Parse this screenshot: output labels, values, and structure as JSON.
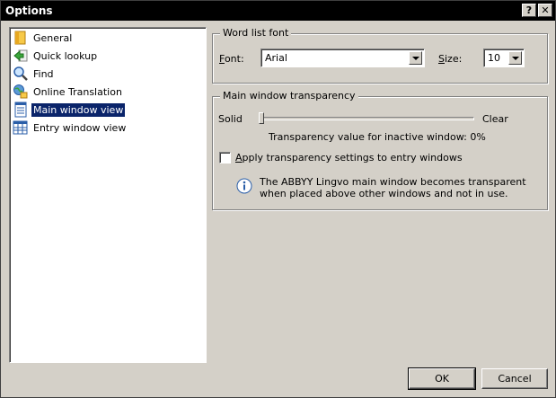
{
  "window": {
    "title": "Options",
    "help_label": "?",
    "close_label": "✕"
  },
  "tree": {
    "items": [
      {
        "label": "General",
        "icon": "folder-icon"
      },
      {
        "label": "Quick lookup",
        "icon": "arrow-icon"
      },
      {
        "label": "Find",
        "icon": "magnifier-icon"
      },
      {
        "label": "Online Translation",
        "icon": "globe-icon"
      },
      {
        "label": "Main window view",
        "icon": "window-icon",
        "selected": true
      },
      {
        "label": "Entry window view",
        "icon": "grid-icon"
      }
    ]
  },
  "word_list_font": {
    "title": "Word list font",
    "font_label": "Font:",
    "font_value": "Arial",
    "size_label": "Size:",
    "size_value": "10"
  },
  "transparency": {
    "title": "Main window transparency",
    "solid_label": "Solid",
    "clear_label": "Clear",
    "value_text": "Transparency value for inactive window: 0%",
    "level_percent": 0,
    "checkbox_label": "Apply transparency settings to entry windows",
    "checkbox_checked": false,
    "info_text": "The ABBYY Lingvo main window becomes transparent when placed above other windows and not in use."
  },
  "buttons": {
    "ok": "OK",
    "cancel": "Cancel"
  }
}
